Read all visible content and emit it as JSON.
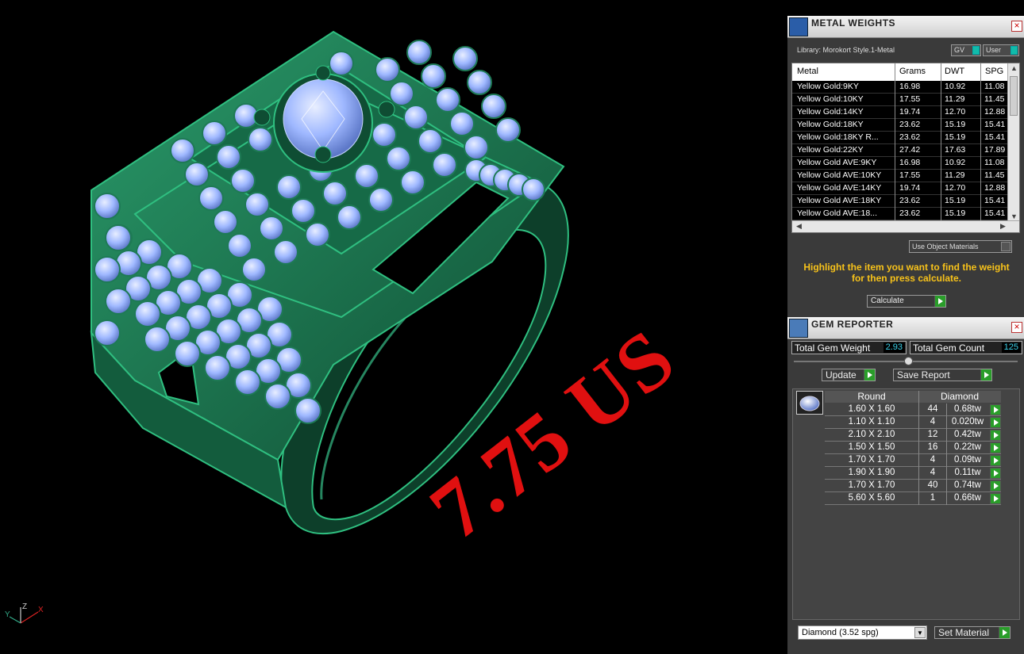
{
  "viewport": {
    "size_label": "7.75 US",
    "axis": {
      "x": "X",
      "y": "Y",
      "z": "Z"
    },
    "colors": {
      "metal": "#1e7a55",
      "gem": "#9fb8ff",
      "size_label": "#e01010"
    }
  },
  "metal_weights": {
    "title": "METAL WEIGHTS",
    "close_icon": "×",
    "library": "Library: Morokort Style.1-Metal",
    "gv_label": "GV",
    "user_label": "User",
    "columns": [
      "Metal",
      "Grams",
      "DWT",
      "SPG"
    ],
    "rows": [
      {
        "metal": "Yellow Gold:9KY",
        "grams": "16.98",
        "dwt": "10.92",
        "spg": "11.08"
      },
      {
        "metal": "Yellow Gold:10KY",
        "grams": "17.55",
        "dwt": "11.29",
        "spg": "11.45"
      },
      {
        "metal": "Yellow Gold:14KY",
        "grams": "19.74",
        "dwt": "12.70",
        "spg": "12.88"
      },
      {
        "metal": "Yellow Gold:18KY",
        "grams": "23.62",
        "dwt": "15.19",
        "spg": "15.41"
      },
      {
        "metal": "Yellow Gold:18KY R...",
        "grams": "23.62",
        "dwt": "15.19",
        "spg": "15.41"
      },
      {
        "metal": "Yellow Gold:22KY",
        "grams": "27.42",
        "dwt": "17.63",
        "spg": "17.89"
      },
      {
        "metal": "Yellow Gold AVE:9KY",
        "grams": "16.98",
        "dwt": "10.92",
        "spg": "11.08"
      },
      {
        "metal": "Yellow Gold AVE:10KY",
        "grams": "17.55",
        "dwt": "11.29",
        "spg": "11.45"
      },
      {
        "metal": "Yellow Gold AVE:14KY",
        "grams": "19.74",
        "dwt": "12.70",
        "spg": "12.88"
      },
      {
        "metal": "Yellow Gold AVE:18KY",
        "grams": "23.62",
        "dwt": "15.19",
        "spg": "15.41"
      },
      {
        "metal": "Yellow Gold AVE:18...",
        "grams": "23.62",
        "dwt": "15.19",
        "spg": "15.41"
      }
    ],
    "use_object_materials": "Use Object Materials",
    "hint": "Highlight the item you want to find the weight for then press calculate.",
    "calculate_label": "Calculate"
  },
  "gem_reporter": {
    "title": "GEM REPORTER",
    "close_icon": "×",
    "total_weight_label": "Total Gem Weight",
    "total_weight_value": "2.93",
    "total_count_label": "Total Gem Count",
    "total_count_value": "125",
    "update_label": "Update",
    "save_report_label": "Save Report",
    "columns": [
      "Round",
      "Diamond"
    ],
    "rows": [
      {
        "size": "1.60 X 1.60",
        "count": "44",
        "weight": "0.68tw"
      },
      {
        "size": "1.10 X 1.10",
        "count": "4",
        "weight": "0.020tw"
      },
      {
        "size": "2.10 X 2.10",
        "count": "12",
        "weight": "0.42tw"
      },
      {
        "size": "1.50 X 1.50",
        "count": "16",
        "weight": "0.22tw"
      },
      {
        "size": "1.70 X 1.70",
        "count": "4",
        "weight": "0.09tw"
      },
      {
        "size": "1.90 X 1.90",
        "count": "4",
        "weight": "0.11tw"
      },
      {
        "size": "1.70 X 1.70",
        "count": "40",
        "weight": "0.74tw"
      },
      {
        "size": "5.60 X 5.60",
        "count": "1",
        "weight": "0.66tw"
      }
    ],
    "material_select": "Diamond     (3.52 spg)",
    "set_material_label": "Set Material"
  }
}
